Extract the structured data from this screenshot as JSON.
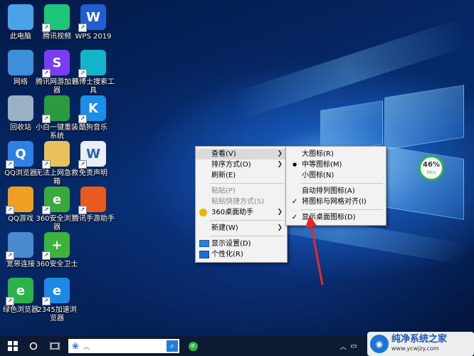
{
  "desktop_icons": [
    {
      "label": "此电脑",
      "icon": "this-pc-icon",
      "color": "#4aa3e8"
    },
    {
      "label": "腾讯视频",
      "icon": "tencent-video-icon",
      "color": "#1ec67a"
    },
    {
      "label": "WPS 2019",
      "icon": "wps-icon",
      "color": "#1f5fd1",
      "glyph": "W"
    },
    {
      "label": "网络",
      "icon": "network-icon",
      "color": "#3c8fd8"
    },
    {
      "label": "腾讯网游加速器",
      "icon": "tencent-game-accelerator-icon",
      "color": "#7a3df0",
      "glyph": "S"
    },
    {
      "label": "韩博士搜索工具",
      "icon": "search-tool-icon",
      "color": "#14b4c8"
    },
    {
      "label": "回收站",
      "icon": "recycle-bin-icon",
      "color": "#9ab0c6"
    },
    {
      "label": "小白一键重装系统",
      "icon": "xiaobai-reinstall-icon",
      "color": "#2a9b3e"
    },
    {
      "label": "酷狗音乐",
      "icon": "kugou-music-icon",
      "color": "#1a8fe8",
      "glyph": "K"
    },
    {
      "label": "QQ浏览器",
      "icon": "qq-browser-icon",
      "color": "#2f7fe6",
      "glyph": "Q"
    },
    {
      "label": "无法上网急救箱",
      "icon": "folder-icon",
      "color": "#e8c15a"
    },
    {
      "label": "免责声明",
      "icon": "document-icon",
      "color": "#e9eef6",
      "glyph": "W"
    },
    {
      "label": "QQ游戏",
      "icon": "qq-game-icon",
      "color": "#f0a020"
    },
    {
      "label": "360安全浏览器",
      "icon": "360-browser-icon",
      "color": "#3aa83a",
      "glyph": "e"
    },
    {
      "label": "腾讯手游助手",
      "icon": "tencent-mobile-game-icon",
      "color": "#e85a20"
    },
    {
      "label": "宽带连接",
      "icon": "broadband-icon",
      "color": "#4a88d0"
    },
    {
      "label": "360安全卫士",
      "icon": "360-safe-icon",
      "color": "#3cb43c",
      "glyph": "+"
    },
    {
      "label": "绿色浏览器",
      "icon": "green-browser-icon",
      "color": "#2bb24a",
      "glyph": "e"
    },
    {
      "label": "2345加速浏览器",
      "icon": "2345-browser-icon",
      "color": "#1e88e5",
      "glyph": "e"
    }
  ],
  "context_menu": {
    "items": [
      {
        "label": "查看(V)",
        "submenu": true,
        "hover": true
      },
      {
        "label": "排序方式(O)",
        "submenu": true
      },
      {
        "label": "刷新(E)"
      },
      {
        "sep": true
      },
      {
        "label": "粘贴(P)",
        "disabled": true
      },
      {
        "label": "粘贴快捷方式(S)",
        "disabled": true
      },
      {
        "label": "360桌面助手",
        "submenu": true,
        "icon": "360-assistant-icon"
      },
      {
        "sep": true
      },
      {
        "label": "新建(W)",
        "submenu": true
      },
      {
        "sep": true
      },
      {
        "label": "显示设置(D)",
        "icon": "display-icon"
      },
      {
        "label": "个性化(R)",
        "icon": "personalize-icon"
      }
    ]
  },
  "view_submenu": {
    "items": [
      {
        "label": "大图标(R)"
      },
      {
        "label": "中等图标(M)",
        "bullet": true
      },
      {
        "label": "小图标(N)"
      },
      {
        "sep": true
      },
      {
        "label": "自动排列图标(A)"
      },
      {
        "label": "将图标与网格对齐(I)",
        "check": true
      },
      {
        "sep": true
      },
      {
        "label": "显示桌面图标(D)",
        "check": true
      }
    ]
  },
  "speed_widget": {
    "percent": "46%",
    "rate": "0K/s"
  },
  "taskbar": {
    "search_placeholder": "",
    "watermark_title": "纯净系统之家",
    "watermark_url": "www.ycwjzy.com"
  },
  "annotation_arrow_color": "#e02a2a"
}
